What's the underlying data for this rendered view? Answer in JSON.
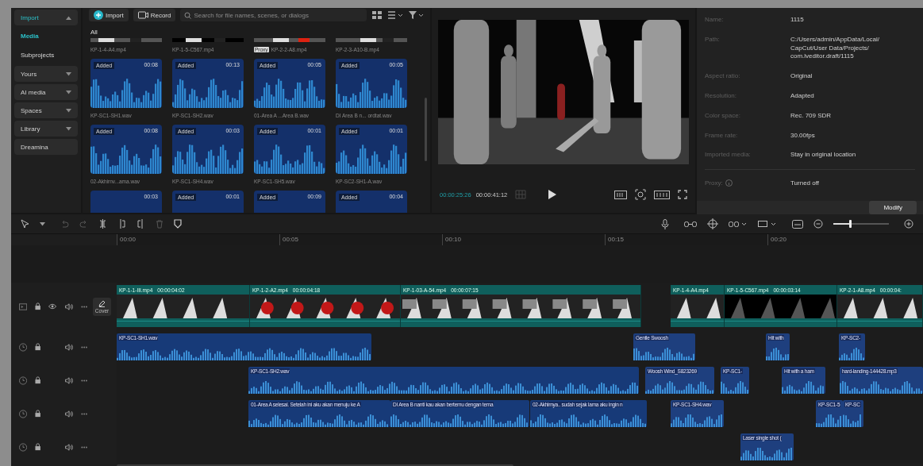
{
  "sidebar": {
    "items": [
      {
        "label": "Import",
        "kind": "group",
        "selected": true,
        "expanded": true
      },
      {
        "label": "Media",
        "kind": "link",
        "selected": true
      },
      {
        "label": "Subprojects",
        "kind": "link",
        "selected": false
      },
      {
        "label": "Yours",
        "kind": "group",
        "selected": false,
        "expanded": false
      },
      {
        "label": "AI media",
        "kind": "group",
        "selected": false,
        "expanded": false
      },
      {
        "label": "Spaces",
        "kind": "group",
        "selected": false,
        "expanded": false
      },
      {
        "label": "Library",
        "kind": "group",
        "selected": false,
        "expanded": false
      },
      {
        "label": "Dreamina",
        "kind": "button",
        "selected": false
      }
    ]
  },
  "media_panel": {
    "import_button": "Import",
    "record_button": "Record",
    "search": {
      "placeholder": "Search for file names, scenes, or dialogs"
    },
    "filter": "All",
    "items": [
      {
        "kind": "video",
        "name": "KP-1-4-A4.mp4",
        "proxy": false
      },
      {
        "kind": "video",
        "name": "KP-1-5-C567.mp4",
        "proxy": false
      },
      {
        "kind": "video",
        "name": "KP-2-2-A8.mp4",
        "proxy": true,
        "proxy_label": "Proxy"
      },
      {
        "kind": "video",
        "name": "KP-2-3-A10-B.mp4",
        "proxy": false
      },
      {
        "kind": "audio",
        "badge": "Added",
        "duration": "00:08",
        "name": "KP-SC1-SH1.wav"
      },
      {
        "kind": "audio",
        "badge": "Added",
        "duration": "00:13",
        "name": "KP-SC1-SH2.wav"
      },
      {
        "kind": "audio",
        "badge": "Added",
        "duration": "00:05",
        "name": "01-Area A ...Area B.wav"
      },
      {
        "kind": "audio",
        "badge": "Added",
        "duration": "00:05",
        "name": "DI Area B n... ordtat.wav"
      },
      {
        "kind": "audio",
        "badge": "Added",
        "duration": "00:08",
        "name": "02-Akhirnv...ama.wav"
      },
      {
        "kind": "audio",
        "badge": "Added",
        "duration": "00:03",
        "name": "KP-SC1-SH4.wav"
      },
      {
        "kind": "audio",
        "badge": "Added",
        "duration": "00:01",
        "name": "KP-SC1-SH5.wav"
      },
      {
        "kind": "audio",
        "badge": "Added",
        "duration": "00:01",
        "name": "KP-SC2-SH1-A.wav"
      },
      {
        "kind": "audio",
        "duration": "00:03"
      },
      {
        "kind": "audio",
        "badge": "Added",
        "duration": "00:01"
      },
      {
        "kind": "audio",
        "badge": "Added",
        "duration": "00:09"
      },
      {
        "kind": "audio",
        "badge": "Added",
        "duration": "00:04"
      }
    ]
  },
  "preview": {
    "current_time": "00:00:25:26",
    "total_time": "00:00:41:12"
  },
  "properties": {
    "rows": [
      {
        "label": "Name:",
        "value": "1115",
        "info": false
      },
      {
        "label": "Path:",
        "value": "C:/Users/admin/AppData/Local/ CapCut/User Data/Projects/ com.lveditor.draft/1115",
        "info": false
      },
      {
        "label": "Aspect ratio:",
        "value": "Original",
        "info": false
      },
      {
        "label": "Resolution:",
        "value": "Adapted",
        "info": false
      },
      {
        "label": "Color space:",
        "value": "Rec. 709 SDR",
        "info": false
      },
      {
        "label": "Frame rate:",
        "value": "30.00fps",
        "info": false
      },
      {
        "label": "Imported media:",
        "value": "Stay in original location",
        "info": false
      },
      {
        "label": "Proxy:",
        "value": "Turned off",
        "info": true
      }
    ],
    "modify_button": "Modify"
  },
  "timeline": {
    "zoom": {
      "level": 0.3
    },
    "ruler": [
      "00:00",
      "00:05",
      "00:10",
      "00:15",
      "00:20"
    ],
    "cover_button": "Cover",
    "video_clips": [
      {
        "name": "KP-1-1-III.mp4",
        "duration": "00:00:04:02"
      },
      {
        "name": "KP-1-2-A2.mp4",
        "duration": "00:00:04:18"
      },
      {
        "name": "KP-1-03-A-54.mp4",
        "duration": "00:00:07:15"
      },
      {
        "name": "KP-1-4-A4.mp4"
      },
      {
        "name": "KP-1-5-C567.mp4",
        "duration": "00:00:03:14"
      },
      {
        "name": "KP-2-1-A8.mp4",
        "duration": "00:00:04:"
      }
    ],
    "audio_tracks": [
      {
        "clips": [
          {
            "name": "KP-SC1-SH1.wav"
          },
          {
            "name": "Gentle Swoosh"
          },
          {
            "name": "Hit with"
          },
          {
            "name": "KP-SC2-"
          }
        ]
      },
      {
        "clips": [
          {
            "name": "KP-SC1-SH2.wav"
          },
          {
            "name": "Woosh Wind_S823269"
          },
          {
            "name": "KP-SC1-"
          },
          {
            "name": "Hit with a ham"
          },
          {
            "name": "hard-landing-144428.mp3"
          }
        ]
      },
      {
        "clips": [
          {
            "name": "01-Area A selesai. Setelah ini aku akan menuju ke A"
          },
          {
            "name": "DI Area B nanti kau akan bertemu dengan tema"
          },
          {
            "name": "02-Akhirnya.. sudah sejak lama aku ingin n"
          },
          {
            "name": "KP-SC1-SH4.wav"
          },
          {
            "name": "KP-SC1-5"
          },
          {
            "name": "KP-SC"
          }
        ]
      },
      {
        "clips": [
          {
            "name": "Laser single shot ("
          }
        ]
      }
    ]
  }
}
